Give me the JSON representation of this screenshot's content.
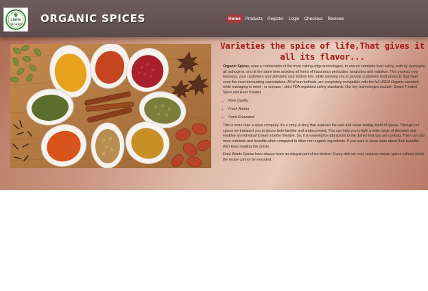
{
  "brand": {
    "name": "ORGANIC SPICES",
    "logo_text_top": "100%",
    "logo_text_bottom": "ORGANIC"
  },
  "nav": [
    "Home",
    "Products",
    "Register",
    "Login",
    "Checkout",
    "Reviews"
  ],
  "nav_active": "Home",
  "colors": {
    "header": "#5e4e4f",
    "active_nav": "#a33b3e",
    "title": "#a51717"
  },
  "main": {
    "title": "Varieties the spice of life,That gives it all its flavor...",
    "intro_bold": "Organic Spices,",
    "intro_rest": " uses a combination of the most cutting edge technologies, to ensure complete food safety, both by destroying all pathogens, and at the same time avoiding all forms of hazardous pesticides, fungicides and radiation. This protects your business, your customers and ultimately your bottom line, while allowing you to provide customers food products that meet even the most demanding expectations. All of our methods, are completely compatible with the full USDA Organic standard, while managing to meet - or surpass - strict FDA regulated safety standards. Our key technologies include: Steam Treated Spice and Heat Treated.",
    "features": [
      "Pure Quality",
      "Fresh Aroma",
      "Hand Grounded"
    ],
    "para2": "This is more than a spice company. It's a story. A story that explores the vast and never ending world of spices. Through our spices we transport you to places both familiar and undiscovered. This can help you to fight a wide range of diseases and enables an individual to lead a better lifestyle. So, it is essential to add spices to the dishes that you are cooking. They can add more nutrients and benefits when compared to other non-organic ingredients. If you want to know more about their benefits, then keep reading this article.",
    "para3": "Final Words Spices have always been an integral part of our kitchen. Every dish we cook requires certain spices without which the recipe cannot be executed."
  }
}
